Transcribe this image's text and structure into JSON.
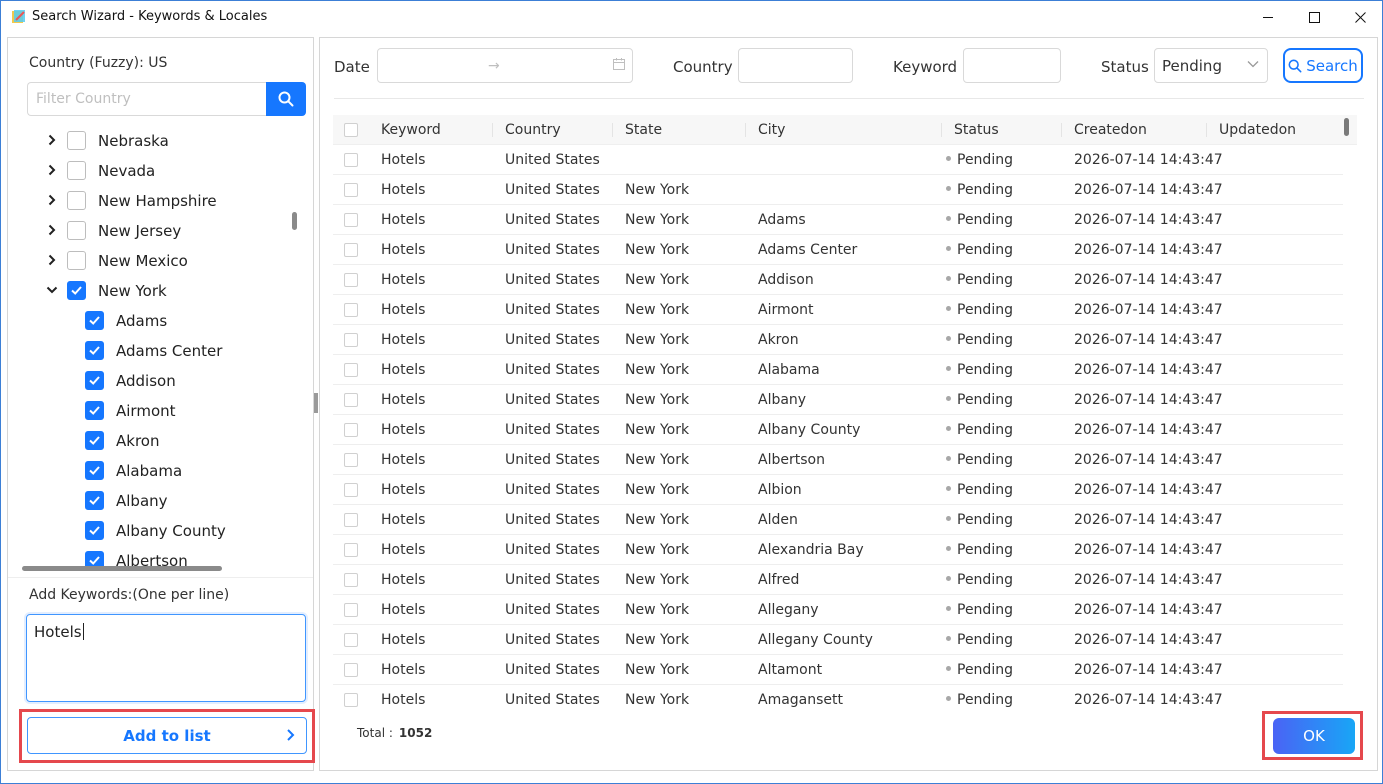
{
  "window": {
    "title": "Search Wizard - Keywords & Locales",
    "minimize": "—",
    "maximize": "☐",
    "close": "✕"
  },
  "left": {
    "country_label": "Country (Fuzzy): US",
    "filter_placeholder": "Filter Country",
    "tree": [
      {
        "label": "Nebraska",
        "level": 0,
        "expanded": false,
        "checked": false
      },
      {
        "label": "Nevada",
        "level": 0,
        "expanded": false,
        "checked": false
      },
      {
        "label": "New Hampshire",
        "level": 0,
        "expanded": false,
        "checked": false
      },
      {
        "label": "New Jersey",
        "level": 0,
        "expanded": false,
        "checked": false
      },
      {
        "label": "New Mexico",
        "level": 0,
        "expanded": false,
        "checked": false
      },
      {
        "label": "New York",
        "level": 0,
        "expanded": true,
        "checked": true
      },
      {
        "label": "Adams",
        "level": 1,
        "checked": true
      },
      {
        "label": "Adams Center",
        "level": 1,
        "checked": true
      },
      {
        "label": "Addison",
        "level": 1,
        "checked": true
      },
      {
        "label": "Airmont",
        "level": 1,
        "checked": true
      },
      {
        "label": "Akron",
        "level": 1,
        "checked": true
      },
      {
        "label": "Alabama",
        "level": 1,
        "checked": true
      },
      {
        "label": "Albany",
        "level": 1,
        "checked": true
      },
      {
        "label": "Albany County",
        "level": 1,
        "checked": true
      },
      {
        "label": "Albertson",
        "level": 1,
        "checked": true
      }
    ],
    "keywords_label": "Add Keywords:(One per line)",
    "keywords_value": "Hotels",
    "add_button": "Add to list"
  },
  "filters": {
    "date_label": "Date",
    "date_arrow": "→",
    "country_label": "Country",
    "keyword_label": "Keyword",
    "status_label": "Status",
    "status_value": "Pending",
    "search_button": "Search"
  },
  "table": {
    "columns": [
      "Keyword",
      "Country",
      "State",
      "City",
      "Status",
      "Createdon",
      "Updatedon"
    ],
    "rows": [
      [
        "Hotels",
        "United States",
        "",
        "",
        "Pending",
        "2026-07-14 14:43:47",
        ""
      ],
      [
        "Hotels",
        "United States",
        "New York",
        "",
        "Pending",
        "2026-07-14 14:43:47",
        ""
      ],
      [
        "Hotels",
        "United States",
        "New York",
        "Adams",
        "Pending",
        "2026-07-14 14:43:47",
        ""
      ],
      [
        "Hotels",
        "United States",
        "New York",
        "Adams Center",
        "Pending",
        "2026-07-14 14:43:47",
        ""
      ],
      [
        "Hotels",
        "United States",
        "New York",
        "Addison",
        "Pending",
        "2026-07-14 14:43:47",
        ""
      ],
      [
        "Hotels",
        "United States",
        "New York",
        "Airmont",
        "Pending",
        "2026-07-14 14:43:47",
        ""
      ],
      [
        "Hotels",
        "United States",
        "New York",
        "Akron",
        "Pending",
        "2026-07-14 14:43:47",
        ""
      ],
      [
        "Hotels",
        "United States",
        "New York",
        "Alabama",
        "Pending",
        "2026-07-14 14:43:47",
        ""
      ],
      [
        "Hotels",
        "United States",
        "New York",
        "Albany",
        "Pending",
        "2026-07-14 14:43:47",
        ""
      ],
      [
        "Hotels",
        "United States",
        "New York",
        "Albany County",
        "Pending",
        "2026-07-14 14:43:47",
        ""
      ],
      [
        "Hotels",
        "United States",
        "New York",
        "Albertson",
        "Pending",
        "2026-07-14 14:43:47",
        ""
      ],
      [
        "Hotels",
        "United States",
        "New York",
        "Albion",
        "Pending",
        "2026-07-14 14:43:47",
        ""
      ],
      [
        "Hotels",
        "United States",
        "New York",
        "Alden",
        "Pending",
        "2026-07-14 14:43:47",
        ""
      ],
      [
        "Hotels",
        "United States",
        "New York",
        "Alexandria Bay",
        "Pending",
        "2026-07-14 14:43:47",
        ""
      ],
      [
        "Hotels",
        "United States",
        "New York",
        "Alfred",
        "Pending",
        "2026-07-14 14:43:47",
        ""
      ],
      [
        "Hotels",
        "United States",
        "New York",
        "Allegany",
        "Pending",
        "2026-07-14 14:43:47",
        ""
      ],
      [
        "Hotels",
        "United States",
        "New York",
        "Allegany County",
        "Pending",
        "2026-07-14 14:43:47",
        ""
      ],
      [
        "Hotels",
        "United States",
        "New York",
        "Altamont",
        "Pending",
        "2026-07-14 14:43:47",
        ""
      ],
      [
        "Hotels",
        "United States",
        "New York",
        "Amagansett",
        "Pending",
        "2026-07-14 14:43:47",
        ""
      ]
    ],
    "total_label": "Total :",
    "total_value": "1052"
  },
  "ok_button": "OK",
  "colors": {
    "accent": "#1677ff",
    "highlight": "#e5484d"
  }
}
